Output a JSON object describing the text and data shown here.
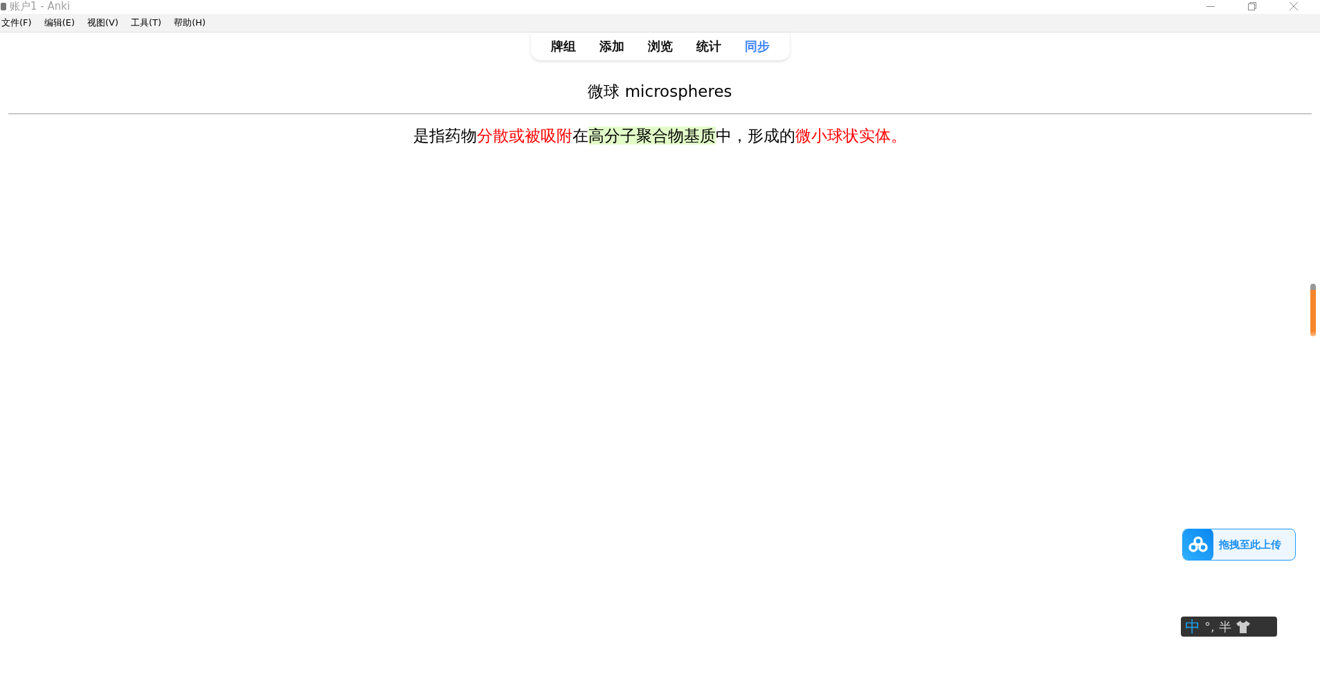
{
  "window": {
    "title": "账户1 - Anki"
  },
  "menu": [
    "文件(F)",
    "编辑(E)",
    "视图(V)",
    "工具(T)",
    "帮助(H)"
  ],
  "tabs": [
    {
      "label": "牌组",
      "selected": false
    },
    {
      "label": "添加",
      "selected": false
    },
    {
      "label": "浏览",
      "selected": false
    },
    {
      "label": "统计",
      "selected": false
    },
    {
      "label": "同步",
      "selected": true
    }
  ],
  "card": {
    "front": "微球 microspheres",
    "back": [
      {
        "text": "是指药物",
        "kind": "plain"
      },
      {
        "text": "分散或被吸附",
        "kind": "red"
      },
      {
        "text": "在",
        "kind": "plain"
      },
      {
        "text": "高分子聚合物基质",
        "kind": "highlight"
      },
      {
        "text": "中，形成的",
        "kind": "plain"
      },
      {
        "text": "微小球状实体。",
        "kind": "red"
      }
    ]
  },
  "upload_widget": {
    "label": "拖拽至此上传"
  },
  "ime_bar": {
    "mode": "中",
    "punctuation": "°,",
    "width": "半"
  }
}
